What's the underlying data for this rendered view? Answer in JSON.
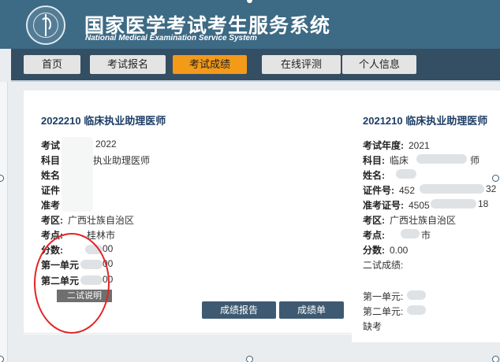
{
  "header": {
    "title_cn": "国家医学考试考生服务系统",
    "title_en": "National Medical Examination Service System"
  },
  "nav": [
    {
      "label": "首页",
      "active": false
    },
    {
      "label": "考试报名",
      "active": false
    },
    {
      "label": "考试成绩",
      "active": true
    },
    {
      "label": "在线评测",
      "active": false
    },
    {
      "label": "个人信息",
      "active": false
    }
  ],
  "left_card": {
    "title": "2022210  临床执业助理医师",
    "exam_year_label": "考试",
    "exam_year_value": "2022",
    "subject_label": "科目",
    "subject_value": "执业助理医师",
    "name_label": "姓名",
    "id_label": "证件",
    "ticket_label": "准考",
    "region_label": "考区:",
    "region_value": "广西壮族自治区",
    "site_label": "考点:",
    "site_value": "桂林市",
    "score_label": "分数:",
    "score_value": "00",
    "unit1_label": "第一单元",
    "unit1_value": "00",
    "unit2_label": "第二单元",
    "unit2_value": "00",
    "explain_button": "二试说明",
    "report_button": "成绩报告",
    "sheet_button": "成绩单"
  },
  "right_card": {
    "title": "2021210  临床执业助理医师",
    "exam_year_label": "考试年度:",
    "exam_year_value": "2021",
    "subject_label": "科目:",
    "subject_value": "临床",
    "subject_value_end": "师",
    "name_label": "姓名:",
    "id_label": "证件号:",
    "id_value": "452",
    "id_value_end": "32",
    "ticket_label": "准考证号:",
    "ticket_value": "4505",
    "ticket_value_end": "18",
    "region_label": "考区:",
    "region_value": "广西壮族自治区",
    "site_label": "考点:",
    "site_value": "市",
    "score_label": "分数:",
    "score_value": "0.00",
    "second_label": "二试成绩:",
    "unit1_label": "第一单元:",
    "unit2_label": "第二单元:",
    "absent_label": "缺考"
  },
  "colors": {
    "header_bg": "#3d6a84",
    "nav_bg": "#344e63",
    "active_tab": "#f39a18",
    "annotation": "#e32326"
  }
}
